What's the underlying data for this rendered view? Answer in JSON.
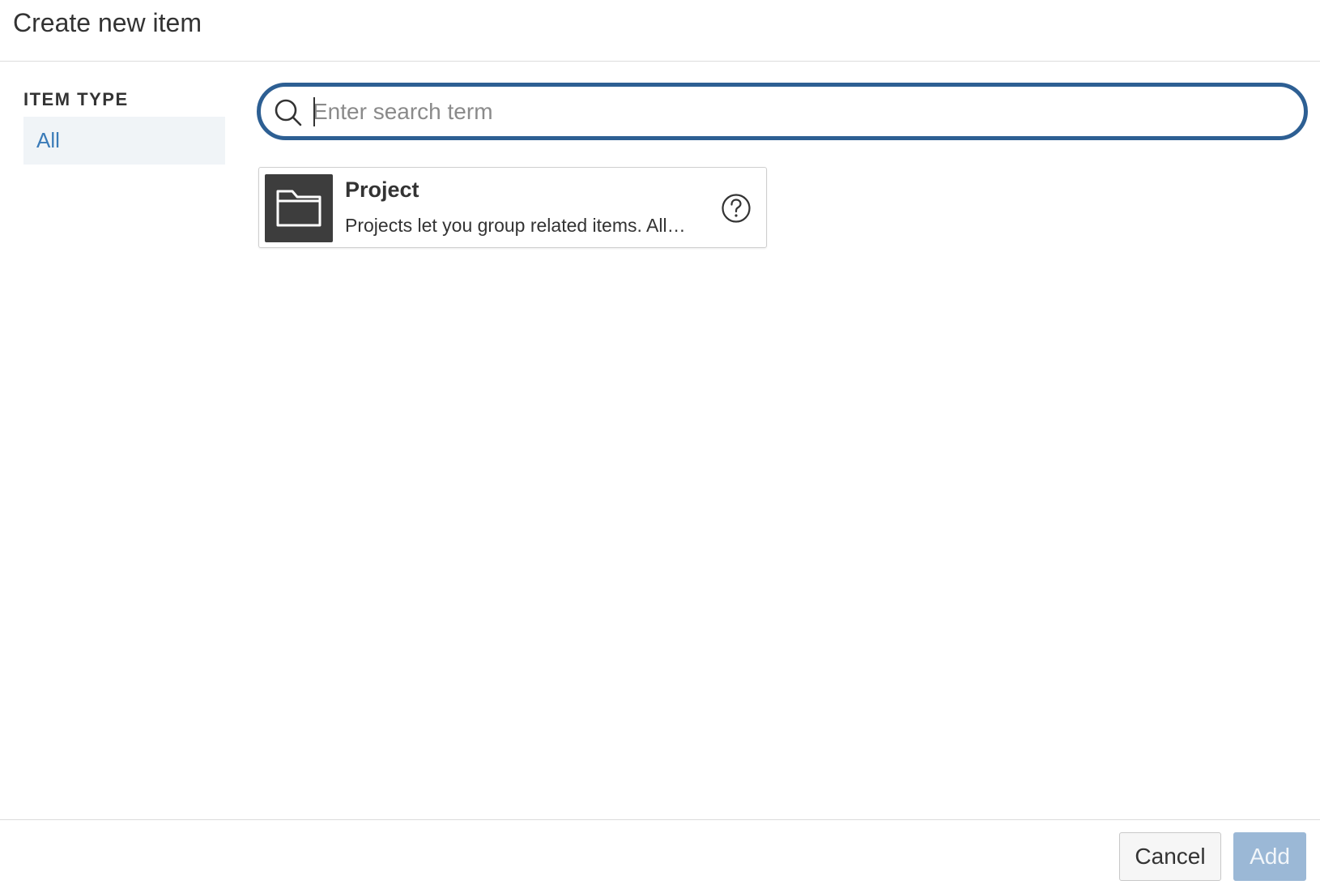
{
  "dialog": {
    "title": "Create new item"
  },
  "sidebar": {
    "heading": "ITEM TYPE",
    "items": [
      {
        "label": "All",
        "selected": true
      }
    ]
  },
  "search": {
    "value": "",
    "placeholder": "Enter search term",
    "icon": "search-icon"
  },
  "results": [
    {
      "title": "Project",
      "description": "Projects let you group related items. All…",
      "icon": "folder-icon",
      "help_icon": "help-circle-icon"
    }
  ],
  "footer": {
    "cancel_label": "Cancel",
    "add_label": "Add",
    "add_enabled": false
  },
  "colors": {
    "accent": "#2d5f93",
    "link": "#3a7bb8",
    "selected_bg": "#f0f4f7",
    "disabled_button": "#9bb8d6",
    "thumb_bg": "#3d3d3d"
  }
}
